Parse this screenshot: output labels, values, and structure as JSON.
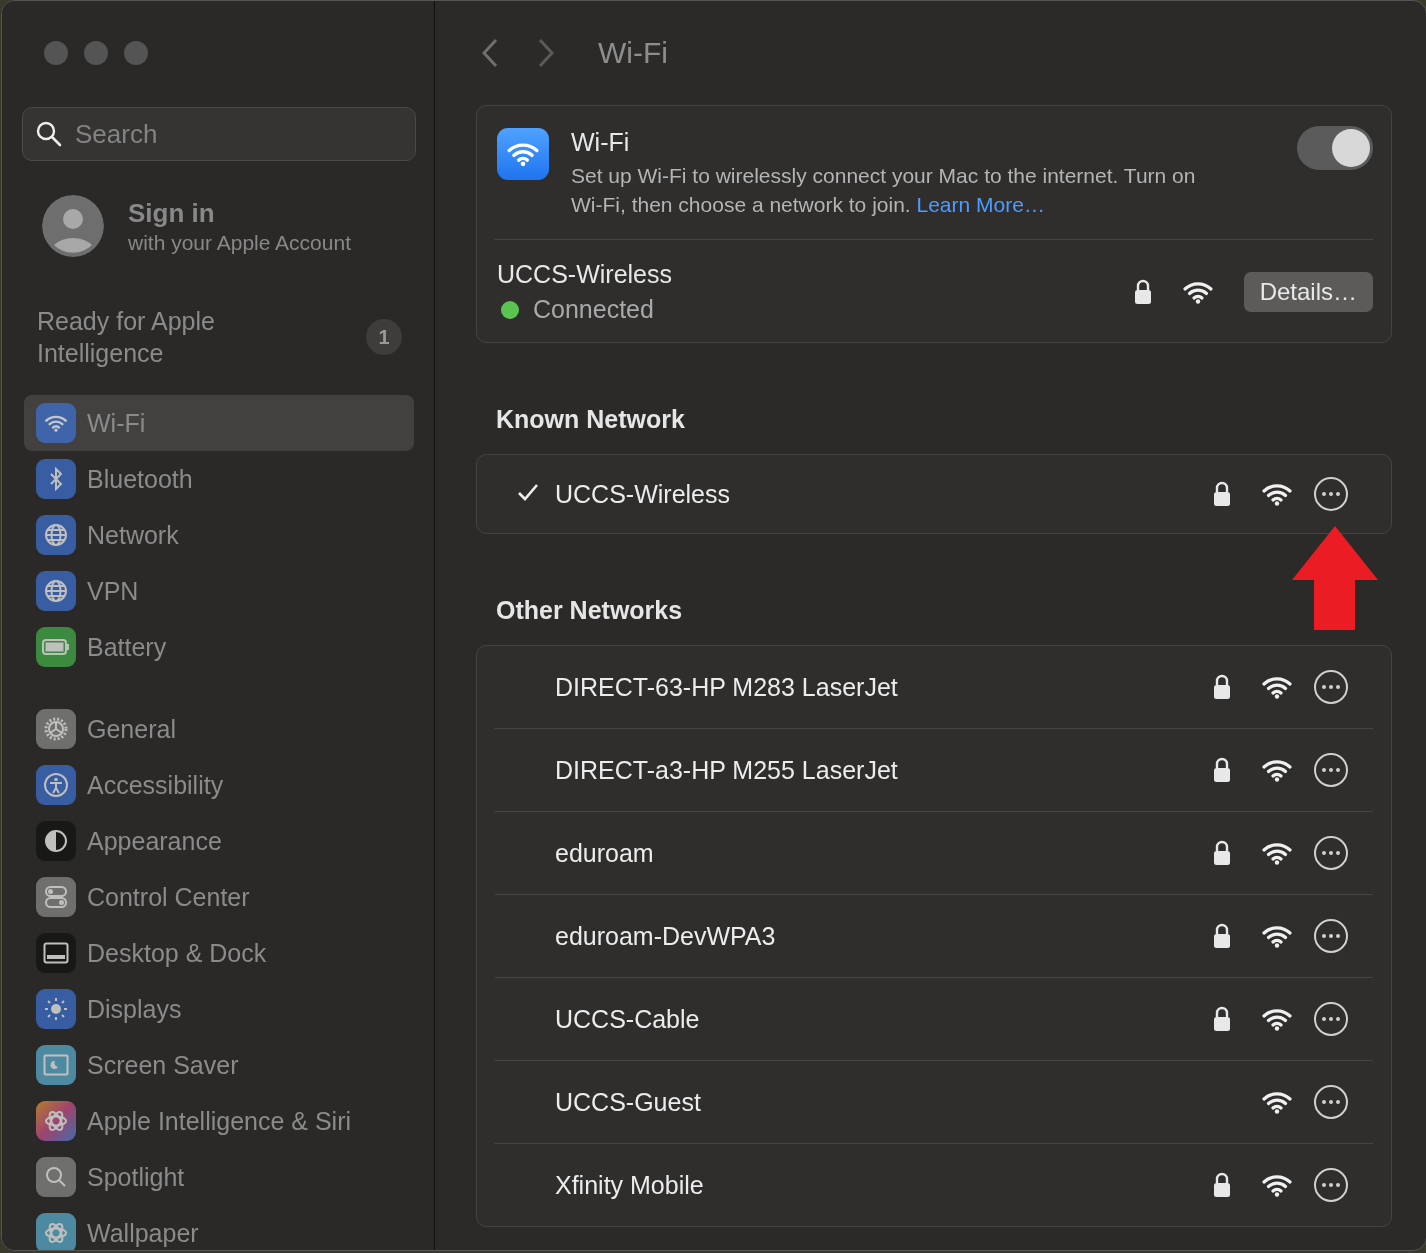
{
  "window": {
    "title": "Wi-Fi"
  },
  "sidebar": {
    "search": {
      "placeholder": "Search"
    },
    "account": {
      "title": "Sign in",
      "subtitle": "with your Apple Account"
    },
    "notice": {
      "text": "Ready for Apple Intelligence",
      "badge": "1"
    },
    "groups": [
      {
        "items": [
          {
            "label": "Wi-Fi",
            "selected": true
          },
          {
            "label": "Bluetooth",
            "selected": false
          },
          {
            "label": "Network",
            "selected": false
          },
          {
            "label": "VPN",
            "selected": false
          },
          {
            "label": "Battery",
            "selected": false
          }
        ]
      },
      {
        "items": [
          {
            "label": "General",
            "selected": false
          },
          {
            "label": "Accessibility",
            "selected": false
          },
          {
            "label": "Appearance",
            "selected": false
          },
          {
            "label": "Control Center",
            "selected": false
          },
          {
            "label": "Desktop & Dock",
            "selected": false
          },
          {
            "label": "Displays",
            "selected": false
          },
          {
            "label": "Screen Saver",
            "selected": false
          },
          {
            "label": "Apple Intelligence & Siri",
            "selected": false
          },
          {
            "label": "Spotlight",
            "selected": false
          },
          {
            "label": "Wallpaper",
            "selected": false
          }
        ]
      }
    ]
  },
  "wifi": {
    "title": "Wi-Fi",
    "description": "Set up Wi-Fi to wirelessly connect your Mac to the internet. Turn on Wi-Fi, then choose a network to join.",
    "link": "Learn More…",
    "on": true,
    "current": {
      "name": "UCCS-Wireless",
      "status": "Connected",
      "color": "#5ac451",
      "locked": true,
      "button": "Details…"
    }
  },
  "known_networks": {
    "title": "Known Network",
    "rows": [
      {
        "name": "UCCS-Wireless",
        "checked": true,
        "locked": true
      }
    ]
  },
  "other_networks": {
    "title": "Other Networks",
    "rows": [
      {
        "name": "DIRECT-63-HP M283 LaserJet",
        "checked": false,
        "locked": true
      },
      {
        "name": "DIRECT-a3-HP M255 LaserJet",
        "checked": false,
        "locked": true
      },
      {
        "name": "eduroam",
        "checked": false,
        "locked": true
      },
      {
        "name": "eduroam-DevWPA3",
        "checked": false,
        "locked": true
      },
      {
        "name": "UCCS-Cable",
        "checked": false,
        "locked": true
      },
      {
        "name": "UCCS-Guest",
        "checked": false,
        "locked": false
      },
      {
        "name": "Xfinity Mobile",
        "checked": false,
        "locked": true
      }
    ]
  }
}
